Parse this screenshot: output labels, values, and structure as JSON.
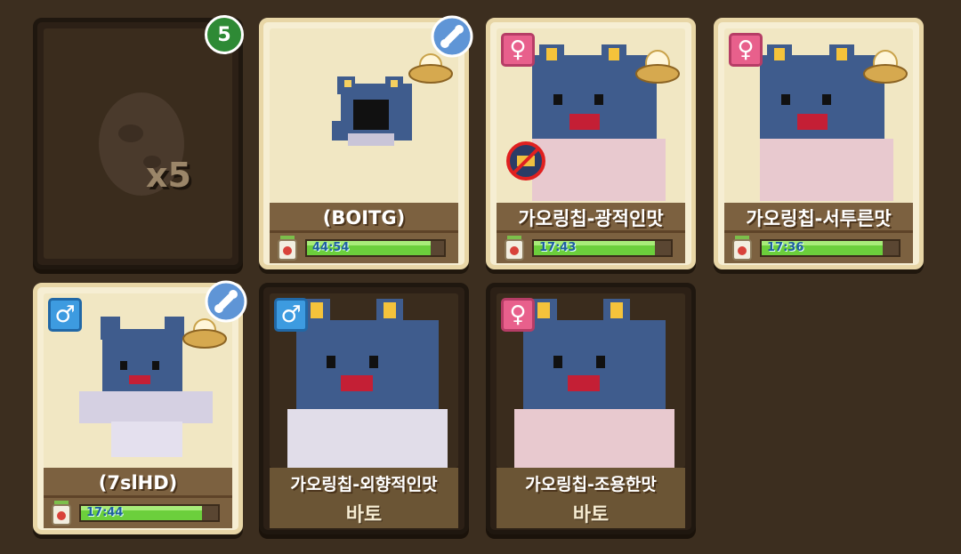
{
  "colors": {
    "background": "#3c2e1f",
    "card_light": "#f6eed3",
    "card_dark": "#2c2016",
    "progress": "#6ccf3c",
    "female": "#e8608c",
    "male": "#3d9be0",
    "badge": "#2e8a35"
  },
  "egg_stack": {
    "count_badge": "5",
    "quantity": "x5"
  },
  "slots": [
    {
      "name": "(BOITG)",
      "timer": "44:54",
      "progress": 0.9,
      "icons": [
        "wrench-icon",
        "nest-egg-icon"
      ]
    },
    {
      "name": "가오링칩-광적인맛",
      "timer": "17:43",
      "progress": 0.88,
      "gender": "♀",
      "icons": [
        "female-icon",
        "nest-egg-icon",
        "no-move-icon"
      ]
    },
    {
      "name": "가오링칩-서투른맛",
      "timer": "17:36",
      "progress": 0.88,
      "gender": "♀",
      "icons": [
        "female-icon",
        "nest-egg-icon"
      ]
    },
    {
      "name": "(7slHD)",
      "timer": "17:44",
      "progress": 0.88,
      "gender": "♂",
      "icons": [
        "male-icon",
        "wrench-icon",
        "nest-egg-icon"
      ]
    },
    {
      "name": "가오링칩-외향적인맛",
      "sub": "바토",
      "gender": "♂",
      "icons": [
        "male-icon"
      ]
    },
    {
      "name": "가오링칩-조용한맛",
      "sub": "바토",
      "gender": "♀",
      "icons": [
        "female-icon"
      ]
    }
  ]
}
